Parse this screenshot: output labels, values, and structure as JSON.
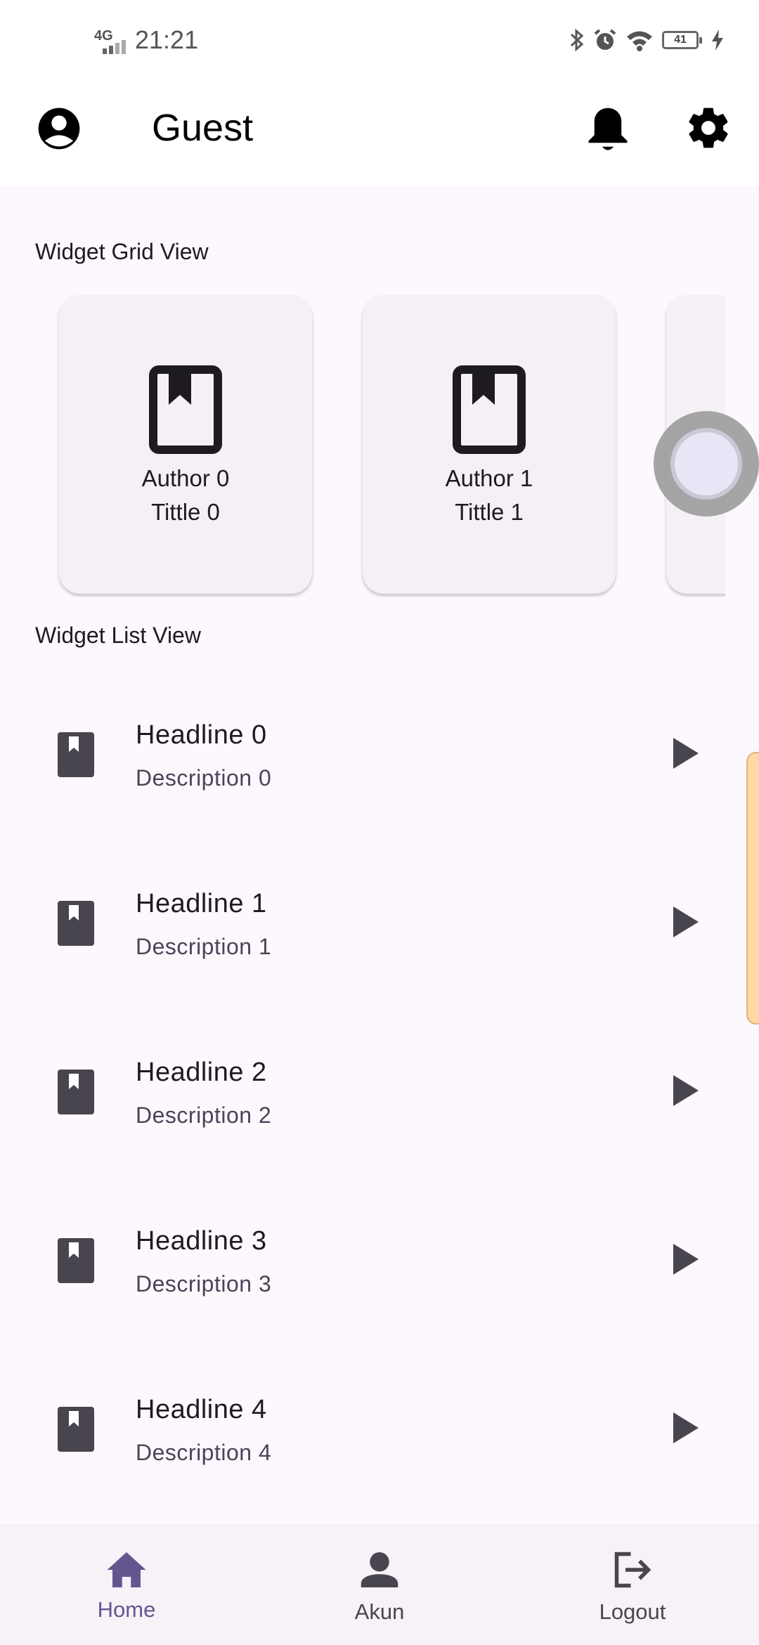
{
  "status_bar": {
    "network": "4G",
    "time": "21:21",
    "battery": "41"
  },
  "app_bar": {
    "title": "Guest"
  },
  "grid_section": {
    "label": "Widget Grid View",
    "cards": [
      {
        "author": "Author 0",
        "title": "Tittle 0"
      },
      {
        "author": "Author 1",
        "title": "Tittle 1"
      }
    ]
  },
  "list_section": {
    "label": "Widget List View",
    "items": [
      {
        "headline": "Headline 0",
        "description": "Description 0"
      },
      {
        "headline": "Headline 1",
        "description": "Description 1"
      },
      {
        "headline": "Headline 2",
        "description": "Description 2"
      },
      {
        "headline": "Headline 3",
        "description": "Description 3"
      },
      {
        "headline": "Headline 4",
        "description": "Description 4"
      }
    ]
  },
  "bottom_nav": {
    "items": [
      {
        "label": "Home",
        "icon": "home-icon",
        "active": true
      },
      {
        "label": "Akun",
        "icon": "person-icon",
        "active": false
      },
      {
        "label": "Logout",
        "icon": "logout-icon",
        "active": false
      }
    ],
    "active_color": "#65558f",
    "inactive_color": "#49454f"
  },
  "colors": {
    "background": "#fdf7fe",
    "card": "#f5eff6",
    "icon_dark": "#49454f"
  }
}
